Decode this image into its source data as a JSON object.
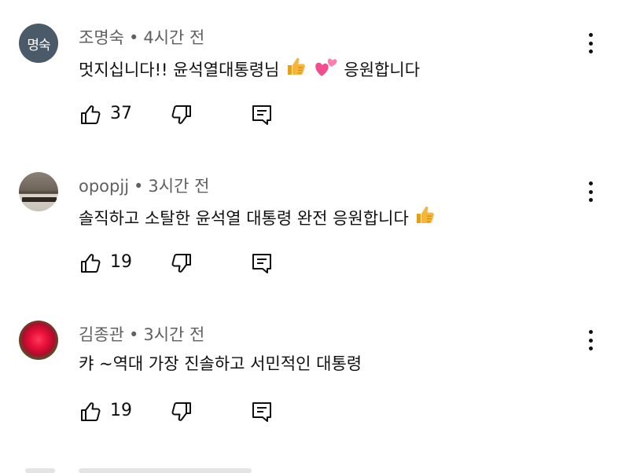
{
  "comments": [
    {
      "author": "조명숙",
      "avatar_text": "명숙",
      "avatar_color": "#4a5a69",
      "time": "4시간 전",
      "text_before": "멋지십니다!! 윤석열대통령님",
      "text_after": "응원합니다",
      "emojis": [
        "thumbs-up-emoji",
        "two-hearts-emoji"
      ],
      "likes": "37"
    },
    {
      "author": "opopjj",
      "time": "3시간 전",
      "text_before": "솔직하고 소탈한 윤석열 대통령 완전 응원합니다",
      "emojis": [
        "thumbs-up-emoji"
      ],
      "likes": "19"
    },
    {
      "author": "김종관",
      "time": "3시간 전",
      "text_before": "캬 ~역대 가장 진솔하고 서민적인 대통령",
      "likes": "19"
    }
  ],
  "icons": {
    "like": "thumbs-up-icon",
    "dislike": "thumbs-down-icon",
    "reply": "reply-icon",
    "more": "more-vertical-icon"
  },
  "colors": {
    "text": "#0f0f0f",
    "meta": "#606060",
    "emoji_yellow": "#f6b63b",
    "emoji_pink": "#f24d8f"
  }
}
